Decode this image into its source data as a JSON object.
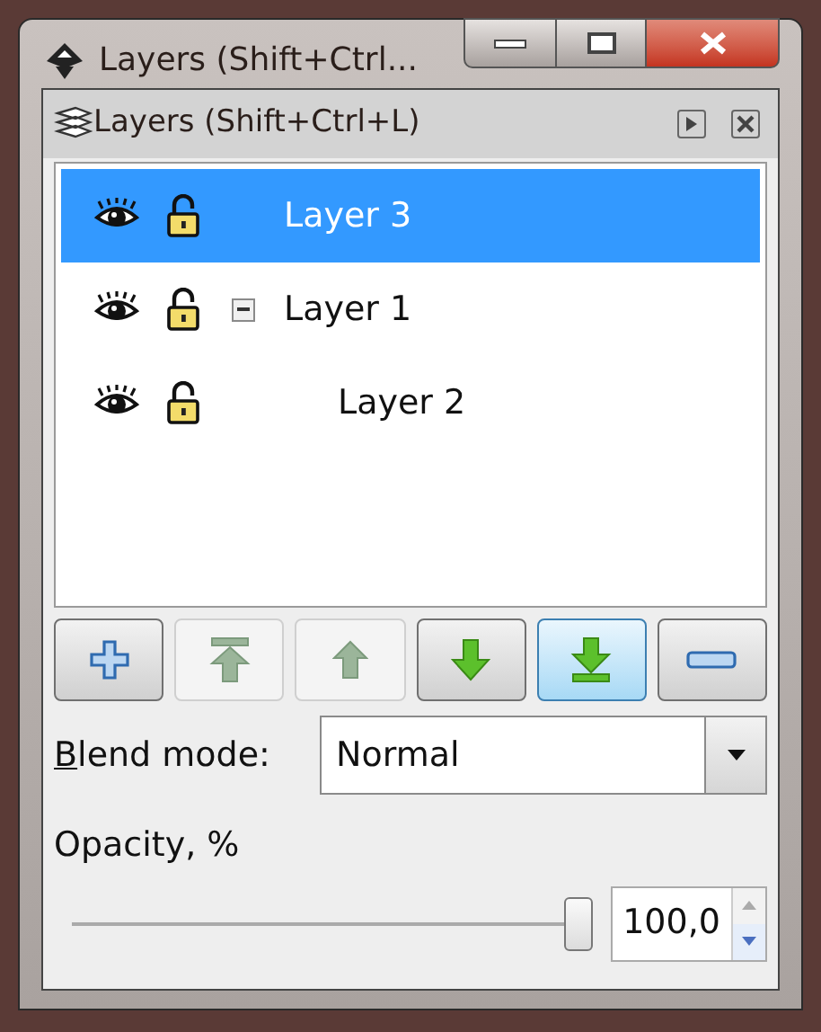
{
  "window": {
    "title": "Layers (Shift+Ctrl..."
  },
  "panel": {
    "title": "Layers (Shift+Ctrl+L)"
  },
  "layers": [
    {
      "name": "Layer 3",
      "visible": true,
      "locked": false,
      "selected": true
    },
    {
      "name": "Layer 1",
      "visible": true,
      "locked": false,
      "selected": false,
      "expanded": true,
      "children": [
        {
          "name": "Layer 2",
          "visible": true,
          "locked": false,
          "selected": false
        }
      ]
    }
  ],
  "toolbar": [
    {
      "kind": "add",
      "disabled": false,
      "hovered": false
    },
    {
      "kind": "top",
      "disabled": true,
      "hovered": false
    },
    {
      "kind": "up",
      "disabled": true,
      "hovered": false
    },
    {
      "kind": "down",
      "disabled": false,
      "hovered": false
    },
    {
      "kind": "bottom",
      "disabled": false,
      "hovered": true
    },
    {
      "kind": "remove",
      "disabled": false,
      "hovered": false
    }
  ],
  "blend": {
    "label": "Blend mode:",
    "mnemonic": true,
    "value": "Normal"
  },
  "opacity": {
    "label": "Opacity, %",
    "level": 1,
    "value": "100,0"
  }
}
